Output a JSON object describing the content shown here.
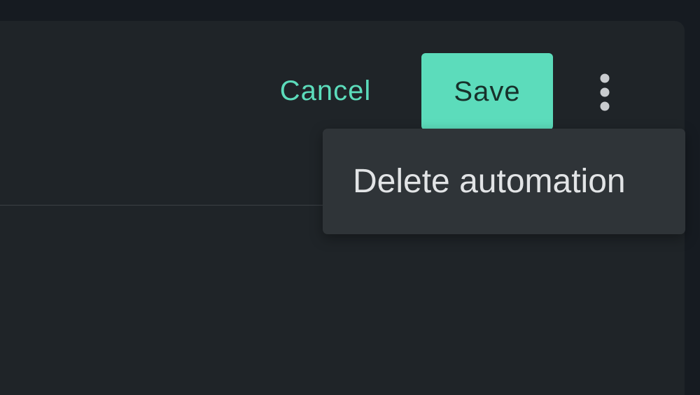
{
  "header": {
    "cancel_label": "Cancel",
    "save_label": "Save",
    "more_icon": "more-vertical-icon"
  },
  "menu": {
    "items": [
      {
        "label": "Delete automation"
      }
    ]
  },
  "colors": {
    "accent": "#5cdcbb",
    "panel": "#1f2428",
    "background": "#161b21",
    "menu": "#2f3438"
  }
}
